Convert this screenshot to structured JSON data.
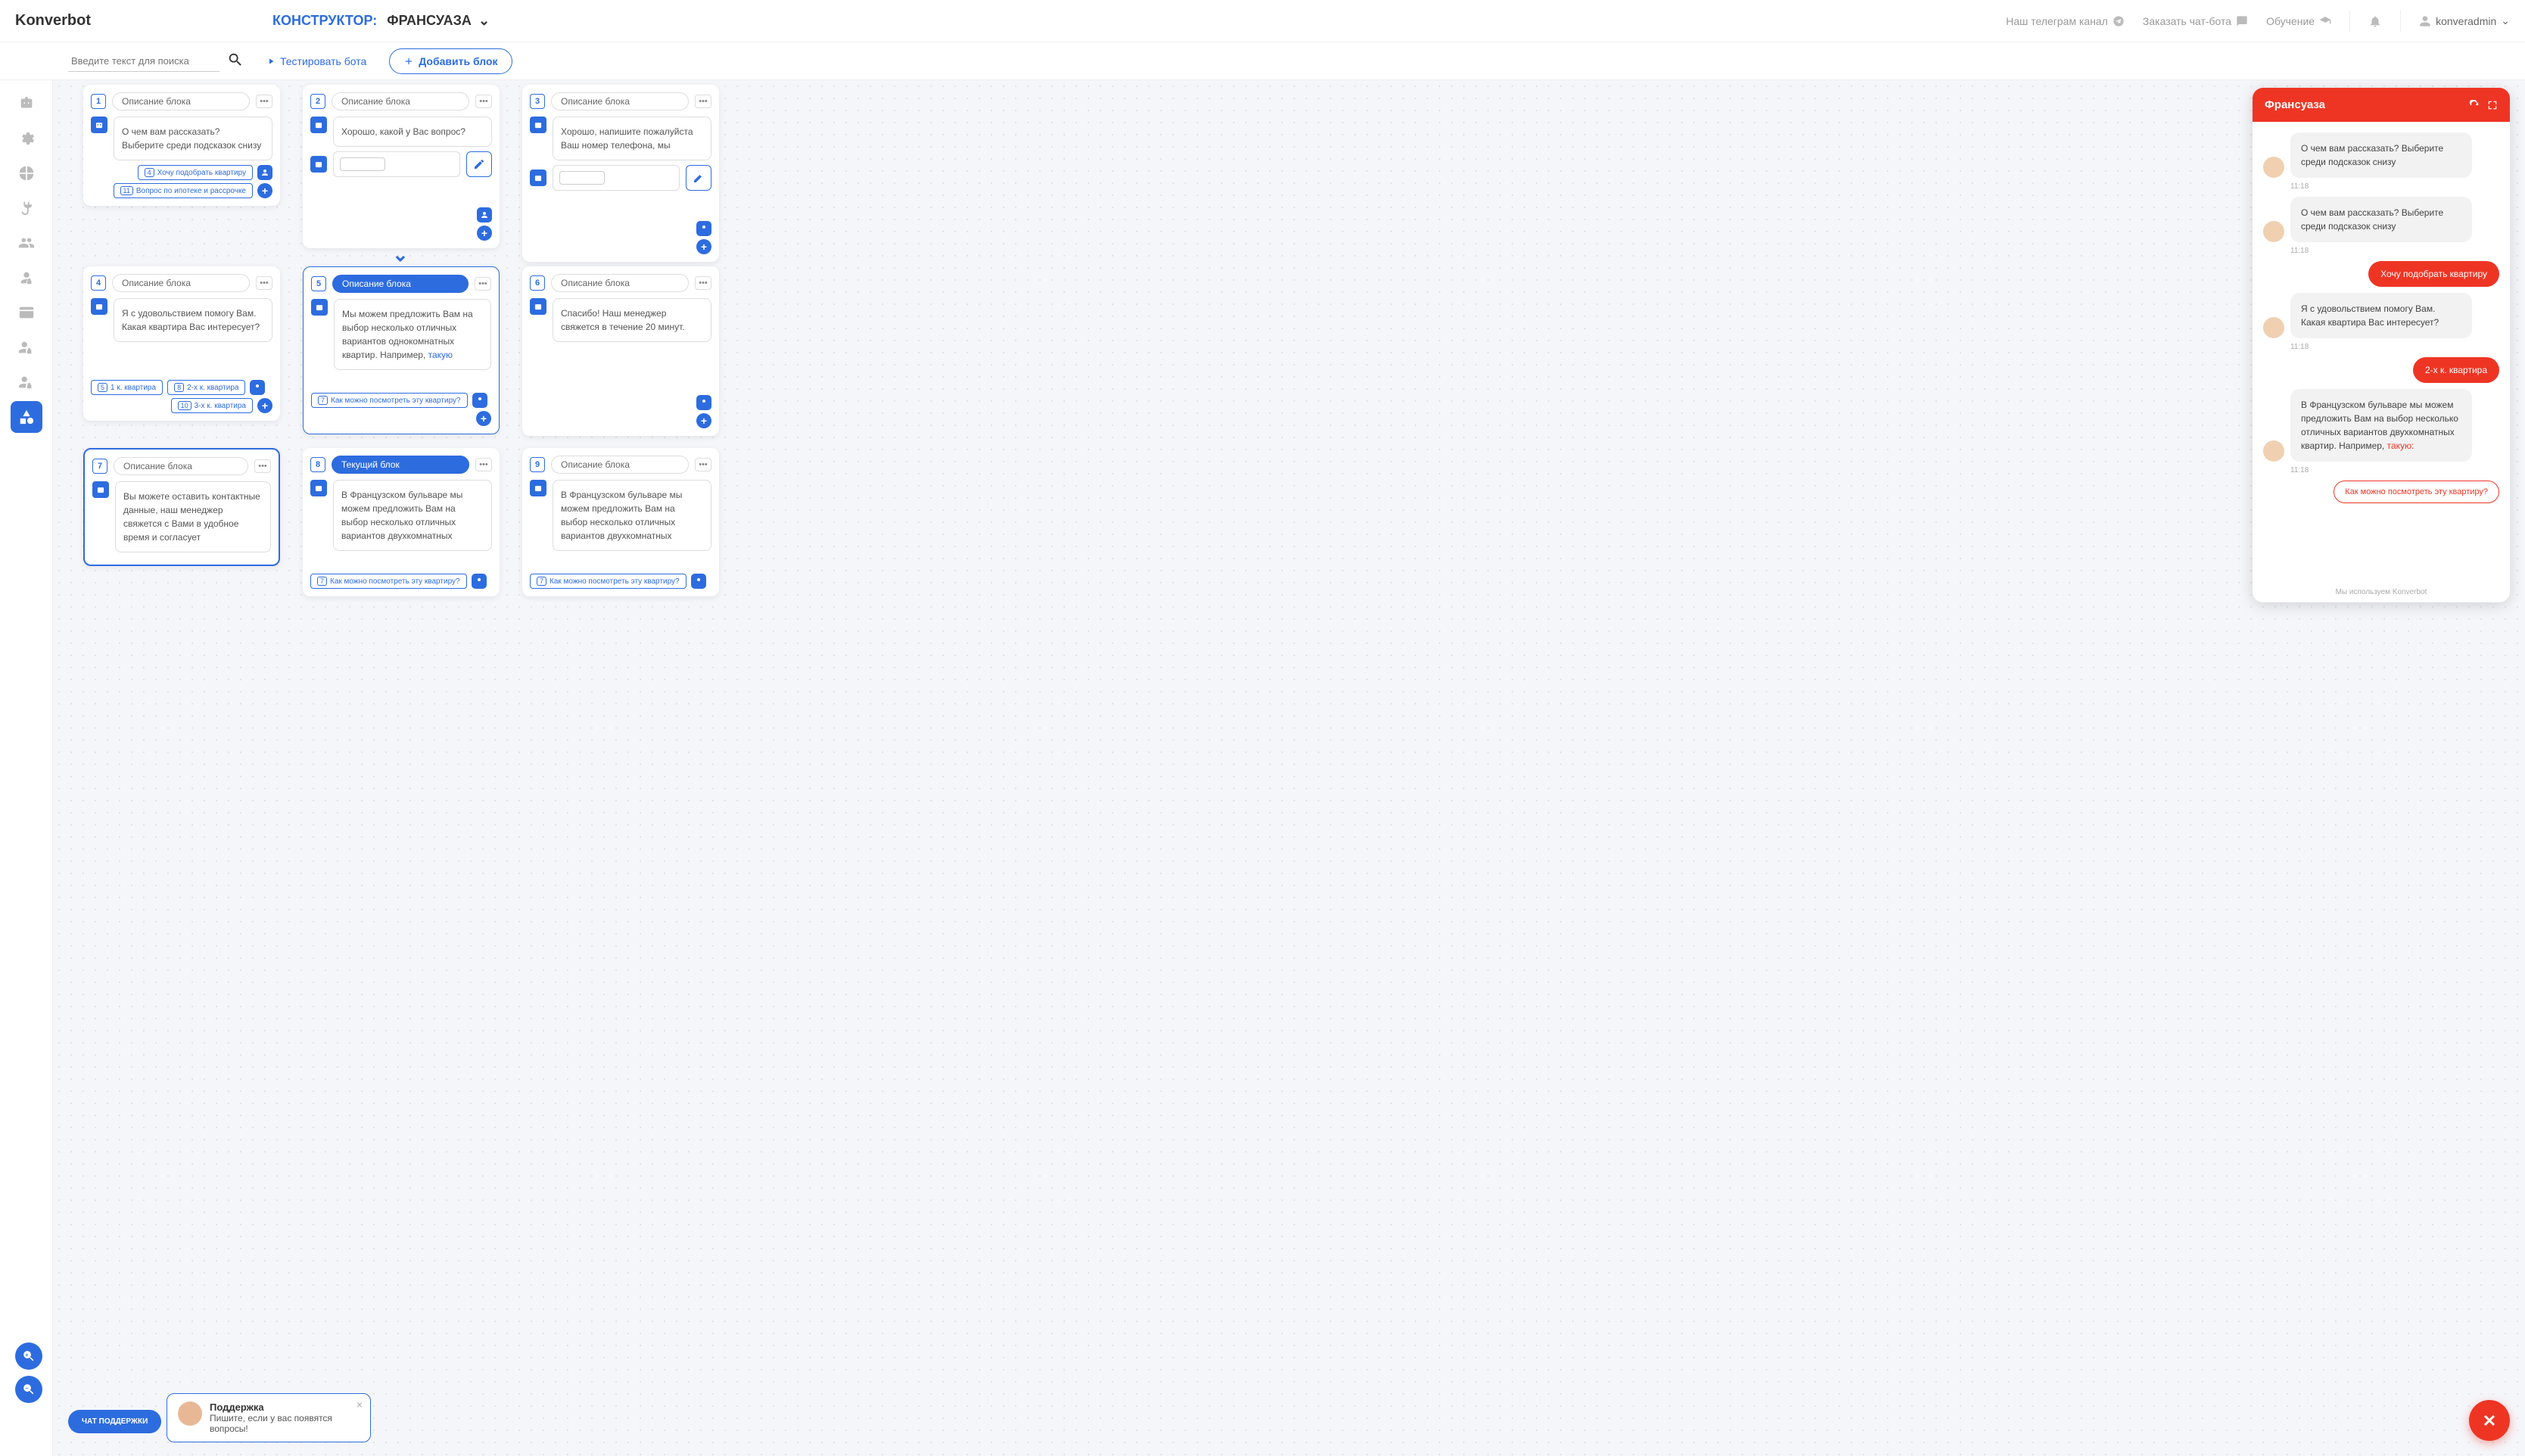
{
  "logo": "Konverbot",
  "header": {
    "title_label": "КОНСТРУКТОР:",
    "title_name": "ФРАНСУАЗА",
    "links": {
      "telegram": "Наш телеграм канал",
      "order": "Заказать чат-бота",
      "training": "Обучение"
    },
    "user": "konveradmin"
  },
  "toolbar": {
    "search_placeholder": "Введите текст для поиска",
    "test_label": "Тестировать бота",
    "add_label": "Добавить блок"
  },
  "card_desc_default": "Описание блока",
  "card_desc_current": "Текущий блок",
  "cards": {
    "c1": {
      "num": "1",
      "msg": "О чем вам рассказать? Выберите среди подсказок снизу",
      "s1_num": "4",
      "s1": "Хочу подобрать квартиру",
      "s2_num": "11",
      "s2": "Вопрос по ипотеке и рассрочке"
    },
    "c2": {
      "num": "2",
      "msg": "Хорошо, какой у Вас вопрос?"
    },
    "c3": {
      "num": "3",
      "msg": "Хорошо, напишите пожалуйста Ваш номер телефона, мы"
    },
    "c4": {
      "num": "4",
      "msg": "Я с удовольствием помогу Вам. Какая квартира Вас интересует?",
      "s1_num": "5",
      "s1": "1 к. квартира",
      "s2_num": "8",
      "s2": "2-х к. квартира",
      "s3_num": "10",
      "s3": "3-х к. квартира"
    },
    "c5": {
      "num": "5",
      "msg": "Мы можем предложить Вам на выбор несколько отличных вариантов однокомнатных квартир. Например, ",
      "link": "такую",
      "s1_num": "7",
      "s1": "Как можно посмотреть эту квартиру?"
    },
    "c6": {
      "num": "6",
      "msg": "Спасибо! Наш менеджер свяжется в течение 20 минут."
    },
    "c7": {
      "num": "7",
      "msg": "Вы можете оставить контактные данные, наш менеджер свяжется с Вами в удобное время и согласует"
    },
    "c8": {
      "num": "8",
      "msg": "В Французском бульваре мы можем предложить Вам на выбор несколько отличных вариантов двухкомнатных",
      "s1_num": "7",
      "s1": "Как можно посмотреть эту квартиру?"
    },
    "c9": {
      "num": "9",
      "msg": "В Французском бульваре мы можем предложить Вам на выбор несколько отличных вариантов двухкомнатных",
      "s1_num": "7",
      "s1": "Как можно посмотреть эту квартиру?"
    }
  },
  "support": {
    "pill": "ЧАТ ПОДДЕРЖКИ",
    "title": "Поддержка",
    "text": "Пишите, если у вас появятся вопросы!"
  },
  "chat": {
    "title": "Франсуаза",
    "time": "11:18",
    "m1": "О чем вам рассказать? Выберите среди подсказок снизу",
    "m2": "О чем вам рассказать? Выберите среди подсказок снизу",
    "u1": "Хочу подобрать квартиру",
    "m3": "Я с удовольствием помогу Вам. Какая квартира Вас интересует?",
    "u2": "2-х к. квартира",
    "m4": "В Французском бульваре мы можем предложить Вам на выбор несколько отличных вариантов двухкомнатных квартир. Например, ",
    "m4_link": "такую:",
    "sug1": "Как можно посмотреть эту квартиру?",
    "footer": "Мы используем Konverbot"
  }
}
